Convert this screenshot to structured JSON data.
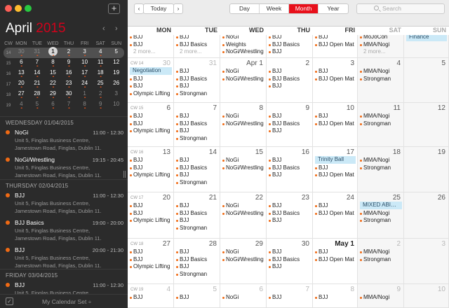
{
  "sidebar": {
    "month": "April",
    "year": "2015",
    "weekday_headers": [
      "CW",
      "MON",
      "TUE",
      "WED",
      "THU",
      "FRI",
      "SAT",
      "SUN"
    ],
    "mini_weeks": [
      {
        "cw": "14",
        "current": true,
        "days": [
          {
            "d": "30",
            "dim": true,
            "dots": "••"
          },
          {
            "d": "31",
            "dim": true,
            "dots": "••"
          },
          {
            "d": "1",
            "today": true,
            "dots": "••"
          },
          {
            "d": "2",
            "dots": "••"
          },
          {
            "d": "3",
            "dots": "••"
          },
          {
            "d": "4",
            "dots": "••"
          },
          {
            "d": "5",
            "dots": ""
          }
        ]
      },
      {
        "cw": "15",
        "days": [
          {
            "d": "6",
            "dots": "••"
          },
          {
            "d": "7",
            "dots": "••"
          },
          {
            "d": "8",
            "dots": "••"
          },
          {
            "d": "9",
            "dots": "••"
          },
          {
            "d": "10",
            "dots": "••"
          },
          {
            "d": "11",
            "dots": "••"
          },
          {
            "d": "12",
            "dots": ""
          }
        ]
      },
      {
        "cw": "16",
        "days": [
          {
            "d": "13",
            "dots": "••"
          },
          {
            "d": "14",
            "dots": "••"
          },
          {
            "d": "15",
            "dots": "••"
          },
          {
            "d": "16",
            "dots": "••"
          },
          {
            "d": "17",
            "dots": "••"
          },
          {
            "d": "18",
            "dots": "••"
          },
          {
            "d": "19",
            "dots": ""
          }
        ]
      },
      {
        "cw": "17",
        "days": [
          {
            "d": "20",
            "dots": "••"
          },
          {
            "d": "21",
            "dots": "••"
          },
          {
            "d": "22",
            "dots": "••"
          },
          {
            "d": "23",
            "dots": "••"
          },
          {
            "d": "24",
            "dots": "••"
          },
          {
            "d": "25",
            "dots": "••"
          },
          {
            "d": "26",
            "dots": ""
          }
        ]
      },
      {
        "cw": "18",
        "days": [
          {
            "d": "27",
            "dots": "••"
          },
          {
            "d": "28",
            "dots": "••"
          },
          {
            "d": "29",
            "dots": "••"
          },
          {
            "d": "30",
            "dots": "••"
          },
          {
            "d": "1",
            "dim": true,
            "dots": "••"
          },
          {
            "d": "2",
            "dim": true,
            "dots": "••"
          },
          {
            "d": "3",
            "dim": true,
            "dots": ""
          }
        ]
      },
      {
        "cw": "19",
        "days": [
          {
            "d": "4",
            "dim": true,
            "dots": "••"
          },
          {
            "d": "5",
            "dim": true,
            "dots": "••"
          },
          {
            "d": "6",
            "dim": true,
            "dots": "••"
          },
          {
            "d": "7",
            "dim": true,
            "dots": "••"
          },
          {
            "d": "8",
            "dim": true,
            "dots": "••"
          },
          {
            "d": "9",
            "dim": true,
            "dots": "••"
          },
          {
            "d": "10",
            "dim": true,
            "dots": ""
          }
        ]
      }
    ],
    "agenda": [
      {
        "header": "WEDNESDAY 01/04/2015",
        "events": [
          {
            "title": "NoGi",
            "time": "11:00 - 12:30",
            "loc": "Unit 5, Finglas Business Centre, Jamestown Road, Finglas, Dublin 11."
          },
          {
            "title": "NoGi/Wrestling",
            "time": "19:15 - 20:45",
            "loc": "Unit 5, Finglas Business Centre, Jamestown Road, Finglas, Dublin 11."
          }
        ]
      },
      {
        "header": "THURSDAY 02/04/2015",
        "events": [
          {
            "title": "BJJ",
            "time": "11:00 - 12:30",
            "loc": "Unit 5, Finglas Business Centre, Jamestown Road, Finglas, Dublin 11."
          },
          {
            "title": "BJJ Basics",
            "time": "19:00 - 20:00",
            "loc": "Unit 5, Finglas Business Centre, Jamestown Road, Finglas, Dublin 11."
          },
          {
            "title": "BJJ",
            "time": "20:00 - 21:30",
            "loc": "Unit 5, Finglas Business Centre, Jamestown Road, Finglas, Dublin 11."
          }
        ]
      },
      {
        "header": "FRIDAY 03/04/2015",
        "events": [
          {
            "title": "BJJ",
            "time": "11:00 - 12:30",
            "loc": "Unit 5, Finglas Business Centre, Jamestown"
          }
        ]
      }
    ],
    "calendar_set": "My Calendar Set ÷"
  },
  "toolbar": {
    "prev": "‹",
    "today": "Today",
    "next": "›",
    "views": [
      {
        "label": "Day"
      },
      {
        "label": "Week"
      },
      {
        "label": "Month",
        "active": true
      },
      {
        "label": "Year"
      }
    ],
    "search_placeholder": "Search"
  },
  "colors": {
    "accent": "#e8101b",
    "event_dot": "#f06a14",
    "bar": "#cbe9f7"
  },
  "day_headers": [
    "MON",
    "TUE",
    "WED",
    "THU",
    "FRI",
    "SAT",
    "SUN"
  ],
  "weeks": [
    {
      "cw": "",
      "days": [
        {
          "d": "",
          "ev": [
            "BJJ",
            "BJJ",
            "2 more..."
          ]
        },
        {
          "d": "",
          "ev": [
            "BJJ",
            "BJJ Basics",
            "2 more..."
          ]
        },
        {
          "d": "",
          "ev": [
            "NoGi",
            "Weights",
            "NoGi/Wrestling"
          ]
        },
        {
          "d": "",
          "ev": [
            "BJJ",
            "BJJ Basics",
            "BJJ"
          ]
        },
        {
          "d": "",
          "ev": [
            "BJJ",
            "BJJ Open Mat"
          ]
        },
        {
          "d": "",
          "ev": [
            "MoJoCon",
            "MMA/Nogi",
            "2 more..."
          ]
        },
        {
          "d": "",
          "ev": [
            "bar:Finance"
          ]
        }
      ]
    },
    {
      "cw": "CW 14",
      "days": [
        {
          "d": "30",
          "ev": [
            "bar:Negotiation",
            "BJJ",
            "BJJ",
            "Olympic Lifting"
          ]
        },
        {
          "d": "31",
          "ev": [
            "BJJ",
            "BJJ Basics",
            "BJJ",
            "Strongman"
          ]
        },
        {
          "d": "Apr 1",
          "ev": [
            "NoGi",
            "NoGi/Wrestling"
          ]
        },
        {
          "d": "2",
          "ev": [
            "BJJ",
            "BJJ Basics",
            "BJJ"
          ]
        },
        {
          "d": "3",
          "ev": [
            "BJJ",
            "BJJ Open Mat"
          ]
        },
        {
          "d": "4",
          "ev": [
            "MMA/Nogi",
            "Strongman"
          ]
        },
        {
          "d": "5",
          "ev": []
        }
      ]
    },
    {
      "cw": "CW 15",
      "days": [
        {
          "d": "6",
          "ev": [
            "BJJ",
            "BJJ",
            "Olympic Lifting"
          ]
        },
        {
          "d": "7",
          "ev": [
            "BJJ",
            "BJJ Basics",
            "BJJ",
            "Strongman"
          ]
        },
        {
          "d": "8",
          "ev": [
            "NoGi",
            "NoGi/Wrestling"
          ]
        },
        {
          "d": "9",
          "ev": [
            "BJJ",
            "BJJ Basics",
            "BJJ"
          ]
        },
        {
          "d": "10",
          "ev": [
            "BJJ",
            "BJJ Open Mat"
          ]
        },
        {
          "d": "11",
          "ev": [
            "MMA/Nogi",
            "Strongman"
          ]
        },
        {
          "d": "12",
          "ev": []
        }
      ]
    },
    {
      "cw": "CW 16",
      "days": [
        {
          "d": "13",
          "ev": [
            "BJJ",
            "BJJ",
            "Olympic Lifting"
          ]
        },
        {
          "d": "14",
          "ev": [
            "BJJ",
            "BJJ Basics",
            "BJJ",
            "Strongman"
          ]
        },
        {
          "d": "15",
          "ev": [
            "NoGi",
            "NoGi/Wrestling"
          ]
        },
        {
          "d": "16",
          "ev": [
            "BJJ",
            "BJJ Basics",
            "BJJ"
          ]
        },
        {
          "d": "17",
          "ev": [
            "bar:Trinity Ball",
            "BJJ",
            "BJJ Open Mat"
          ]
        },
        {
          "d": "18",
          "ev": [
            "MMA/Nogi",
            "Strongman"
          ]
        },
        {
          "d": "19",
          "ev": []
        }
      ]
    },
    {
      "cw": "CW 17",
      "days": [
        {
          "d": "20",
          "ev": [
            "BJJ",
            "BJJ",
            "Olympic Lifting"
          ]
        },
        {
          "d": "21",
          "ev": [
            "BJJ",
            "BJJ Basics",
            "BJJ",
            "Strongman"
          ]
        },
        {
          "d": "22",
          "ev": [
            "NoGi",
            "NoGi/Wrestling"
          ]
        },
        {
          "d": "23",
          "ev": [
            "BJJ",
            "BJJ Basics",
            "BJJ"
          ]
        },
        {
          "d": "24",
          "ev": [
            "BJJ",
            "BJJ Open Mat"
          ]
        },
        {
          "d": "25",
          "ev": [
            "bar:MIXED ABI…",
            "MMA/Nogi",
            "Strongman"
          ]
        },
        {
          "d": "26",
          "ev": []
        }
      ]
    },
    {
      "cw": "CW 18",
      "days": [
        {
          "d": "27",
          "ev": [
            "BJJ",
            "BJJ",
            "Olympic Lifting"
          ]
        },
        {
          "d": "28",
          "ev": [
            "BJJ",
            "BJJ Basics",
            "BJJ",
            "Strongman"
          ]
        },
        {
          "d": "29",
          "ev": [
            "NoGi",
            "NoGi/Wrestling"
          ]
        },
        {
          "d": "30",
          "ev": [
            "BJJ",
            "BJJ Basics",
            "BJJ"
          ]
        },
        {
          "d": "May 1",
          "bold": true,
          "ev": [
            "BJJ",
            "BJJ Open Mat"
          ]
        },
        {
          "d": "2",
          "ev": [
            "MMA/Nogi",
            "Strongman"
          ]
        },
        {
          "d": "3",
          "ev": []
        }
      ]
    },
    {
      "cw": "CW 19",
      "days": [
        {
          "d": "4",
          "ev": [
            "BJJ"
          ]
        },
        {
          "d": "5",
          "ev": [
            "BJJ"
          ]
        },
        {
          "d": "6",
          "ev": [
            "NoGi"
          ]
        },
        {
          "d": "7",
          "ev": [
            "BJJ"
          ]
        },
        {
          "d": "8",
          "ev": [
            "BJJ"
          ]
        },
        {
          "d": "9",
          "ev": [
            "MMA/Nogi"
          ]
        },
        {
          "d": "10",
          "ev": []
        }
      ]
    }
  ]
}
